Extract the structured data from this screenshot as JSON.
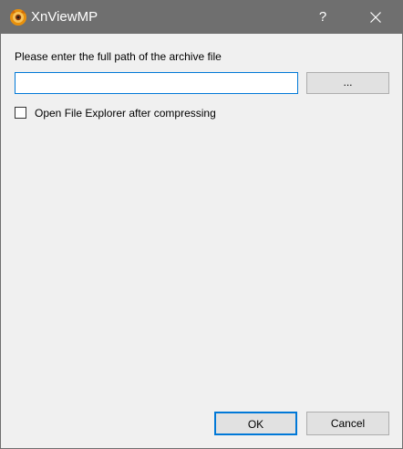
{
  "window": {
    "title": "XnViewMP",
    "help_label": "?",
    "icon": "xnviewmp-app-icon",
    "close_icon": "close-icon"
  },
  "dialog": {
    "prompt": "Please enter the full path of the archive file",
    "path_input": {
      "value": "",
      "placeholder": ""
    },
    "browse_label": "...",
    "open_explorer": {
      "label": "Open File Explorer after compressing",
      "checked": false
    },
    "ok_label": "OK",
    "cancel_label": "Cancel"
  },
  "colors": {
    "titlebar": "#6f6f6f",
    "background": "#f0f0f0",
    "accent": "#0078d7",
    "button": "#e1e1e1"
  }
}
